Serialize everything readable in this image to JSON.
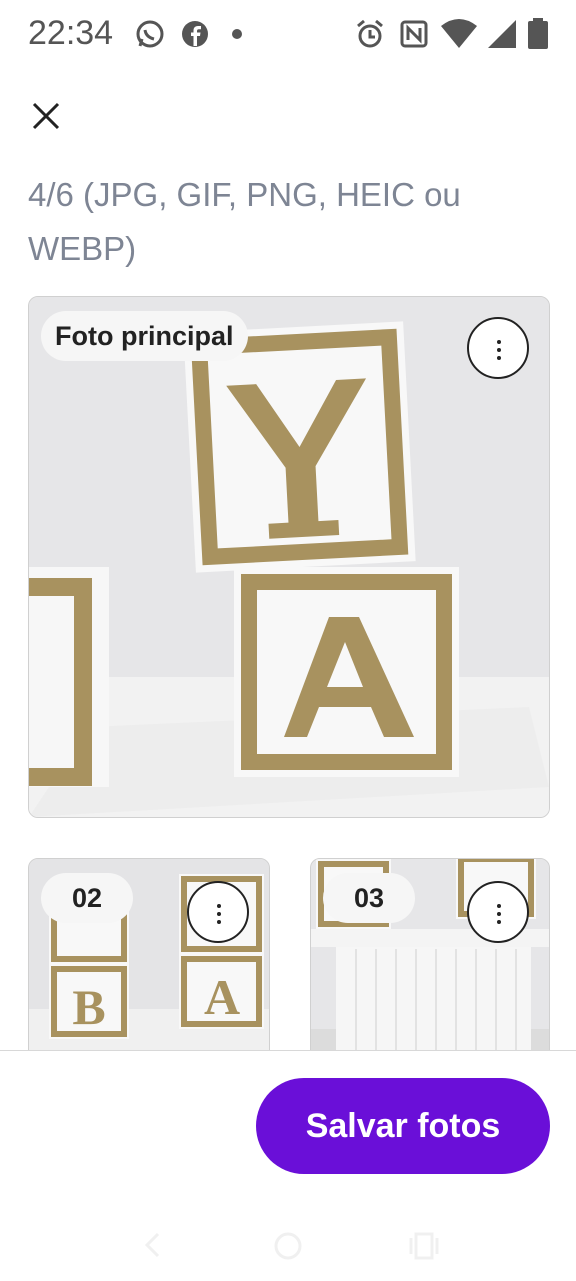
{
  "status_bar": {
    "time": "22:34"
  },
  "header": {
    "subtitle": "4/6 (JPG, GIF, PNG, HEIC ou WEBP)"
  },
  "photos": {
    "main_label": "Foto principal",
    "thumbs": [
      {
        "label": "02"
      },
      {
        "label": "03"
      }
    ]
  },
  "footer": {
    "save_label": "Salvar fotos"
  },
  "colors": {
    "accent": "#6a0fd8",
    "subtitle": "#7e8594",
    "gold": "#a8925f"
  },
  "icons": [
    "whatsapp-icon",
    "facebook-icon",
    "alarm-icon",
    "nfc-icon",
    "wifi-icon",
    "signal-icon",
    "battery-icon",
    "close-icon",
    "more-vert-icon",
    "back-icon",
    "home-icon",
    "recents-icon"
  ]
}
